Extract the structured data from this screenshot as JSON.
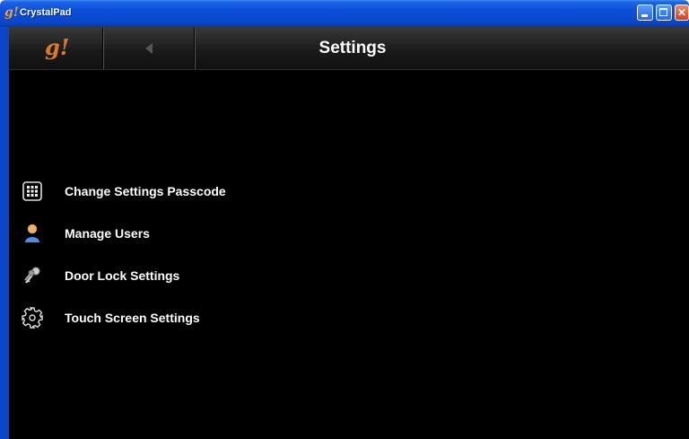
{
  "window": {
    "title": "CrystalPad",
    "icon_text": "g!",
    "controls": [
      "minimize",
      "maximize",
      "close"
    ]
  },
  "header": {
    "logo_text": "g!",
    "back_icon": "back-arrow-icon",
    "title": "Settings"
  },
  "menu": {
    "items": [
      {
        "label": "Change Settings Passcode",
        "icon": "keypad-icon"
      },
      {
        "label": "Manage Users",
        "icon": "user-icon"
      },
      {
        "label": "Door Lock Settings",
        "icon": "keys-icon"
      },
      {
        "label": "Touch Screen Settings",
        "icon": "gear-icon"
      }
    ]
  },
  "colors": {
    "titlebar": "#0a46c7",
    "logo": "#e07a1e",
    "background": "#000000",
    "text": "#ffffff"
  }
}
